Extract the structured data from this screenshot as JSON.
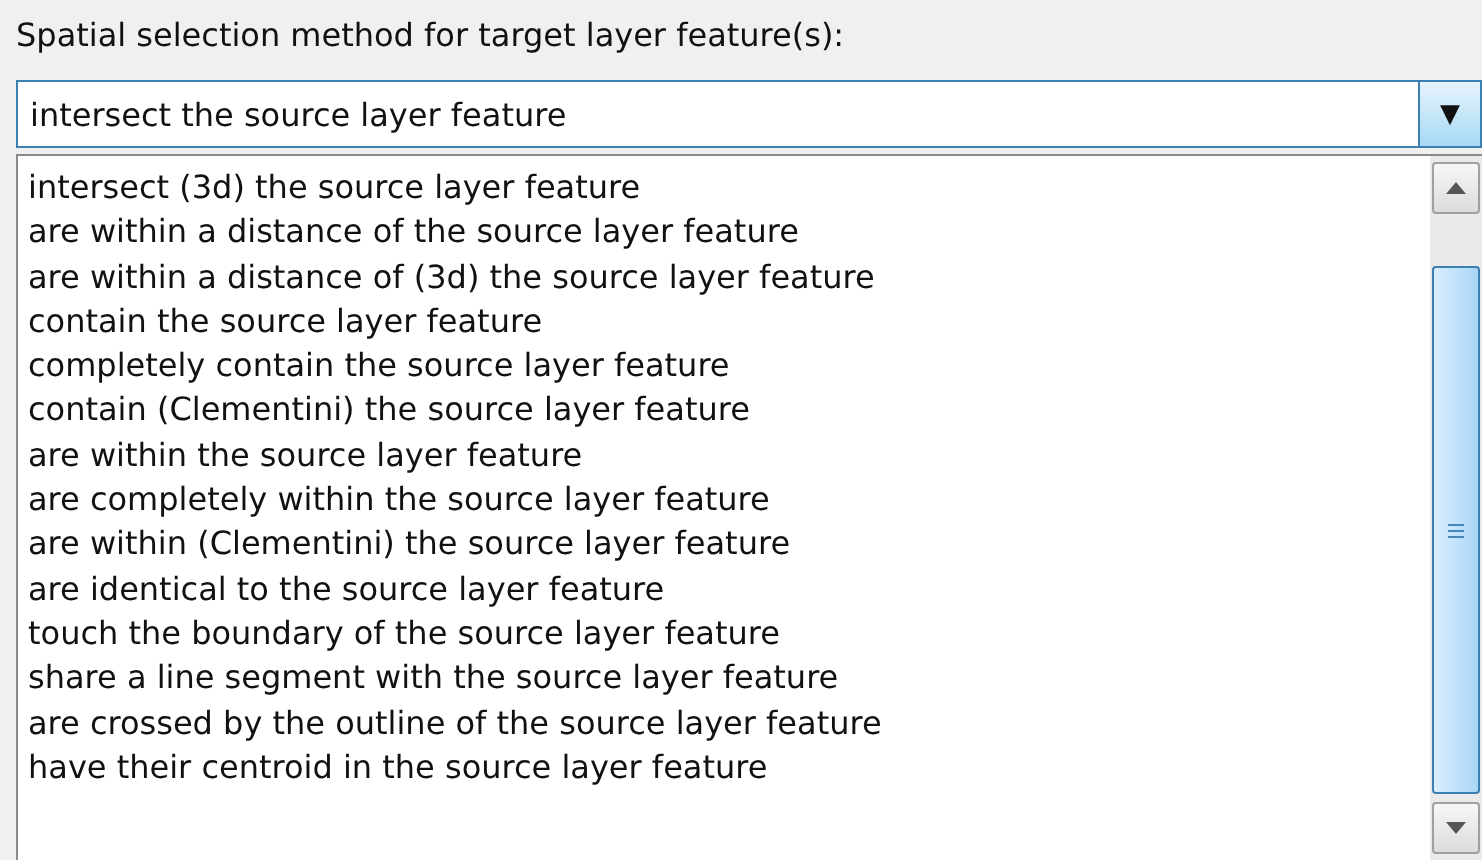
{
  "label": "Spatial selection method for target layer feature(s):",
  "combo": {
    "value": "intersect the source layer feature",
    "dropdown_glyph": "▼"
  },
  "options": [
    {
      "text": "intersect (3d) the source layer feature",
      "selected": false
    },
    {
      "text": "are within a distance of the source layer feature",
      "selected": false
    },
    {
      "text": "are within a distance of (3d) the source layer feature",
      "selected": false
    },
    {
      "text": "contain the source layer feature",
      "selected": false
    },
    {
      "text": "completely contain the source layer feature",
      "selected": false
    },
    {
      "text": "contain (Clementini) the source layer feature",
      "selected": false
    },
    {
      "text": "are within the source layer feature",
      "selected": false
    },
    {
      "text": "are completely within the source layer feature",
      "selected": false
    },
    {
      "text": "are within (Clementini) the source layer feature",
      "selected": false
    },
    {
      "text": "are identical to the source layer feature",
      "selected": false
    },
    {
      "text": "touch the boundary of the source layer feature",
      "selected": false
    },
    {
      "text": "share a line segment with the source layer feature",
      "selected": false
    },
    {
      "text": "are crossed by the outline of the source layer feature",
      "selected": false
    },
    {
      "text": "have their centroid in the source layer feature",
      "selected": false
    }
  ]
}
